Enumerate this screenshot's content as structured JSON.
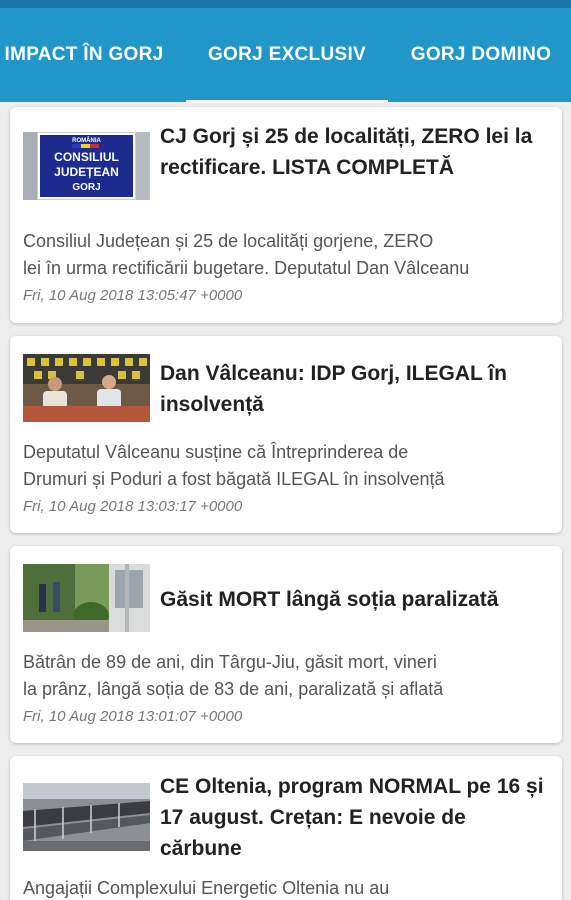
{
  "tabs": [
    {
      "label": "IMPACT ÎN GORJ"
    },
    {
      "label": "GORJ EXCLUSIV"
    },
    {
      "label": "GORJ DOMINO"
    }
  ],
  "articles": [
    {
      "title": "CJ Gorj și 25 de localități, ZERO lei la rectificare. LISTA COMPLETĂ",
      "summary_line1": "Consiliul Județean și 25 de localități gorjene, ZERO",
      "summary_line2": "lei în urma rectificării bugetare.  Deputatul Dan Vâlceanu",
      "date": "Fri, 10 Aug 2018 13:05:47 +0000",
      "thumb_text": {
        "l1": "ROMÂNIA",
        "l2": "CONSILIUL",
        "l3": "JUDEȚEAN",
        "l4": "GORJ"
      }
    },
    {
      "title": "Dan Vâlceanu: IDP Gorj, ILEGAL în insolvență",
      "summary_line1": "Deputatul Vâlceanu susține că Întreprinderea de",
      "summary_line2": "Drumuri și Poduri a fost băgată ILEGAL în insolvență",
      "date": "Fri, 10 Aug 2018 13:03:17 +0000"
    },
    {
      "title": "Găsit MORT lângă soția paralizată",
      "summary_line1": "Bătrân de 89 de ani, din Târgu-Jiu, găsit mort, vineri",
      "summary_line2": "la prânz, lângă soția de 83 de ani,  paralizată și aflată",
      "date": "Fri, 10 Aug 2018 13:01:07 +0000"
    },
    {
      "title": "CE Oltenia, program NORMAL pe 16 și 17 august. Crețan: E nevoie de cărbune",
      "summary_line1": "Angajații Complexului Energetic Oltenia nu au"
    }
  ],
  "colors": {
    "tab_bar": "#2196c9",
    "status_bar": "#1976a8",
    "card_bg": "#ffffff",
    "page_bg": "#eeeeee"
  }
}
